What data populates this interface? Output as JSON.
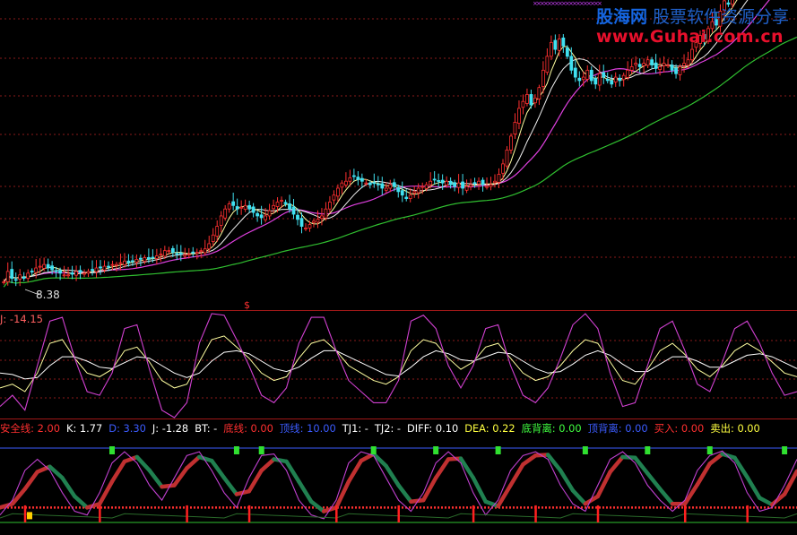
{
  "watermark": {
    "brand": "股海网",
    "tagline": "股票软件资源分享",
    "url": "www.Guhai.com.cn"
  },
  "main_panel": {
    "low_price_label": "8.38",
    "marker": "$"
  },
  "kdj_panel": {
    "j_readout": "J: -14.15"
  },
  "legend": [
    {
      "text": "安全线: 2.00",
      "color": "#ff3030"
    },
    {
      "text": "K: 1.77",
      "color": "#ffffff"
    },
    {
      "text": "D: 3.30",
      "color": "#3c5cff"
    },
    {
      "text": "J: -1.28",
      "color": "#ffffff"
    },
    {
      "text": "BT: -",
      "color": "#ffffff"
    },
    {
      "text": "底线: 0.00",
      "color": "#ff3030"
    },
    {
      "text": "顶线: 10.00",
      "color": "#3c5cff"
    },
    {
      "text": "TJ1: -",
      "color": "#ffffff"
    },
    {
      "text": "TJ2: -",
      "color": "#ffffff"
    },
    {
      "text": "DIFF: 0.10",
      "color": "#ffffff"
    },
    {
      "text": "DEA: 0.22",
      "color": "#ffff40"
    },
    {
      "text": "底背离: 0.00",
      "color": "#40ff40"
    },
    {
      "text": "顶背离: 0.00",
      "color": "#3c5cff"
    },
    {
      "text": "买入: 0.00",
      "color": "#ff3030"
    },
    {
      "text": "卖出: 0.00",
      "color": "#ffff40"
    }
  ],
  "colors": {
    "up": "#ff3030",
    "down": "#40e0f0",
    "ma_short": "#ffffff",
    "ma_mid": "#e040e0",
    "ma_long": "#30c030",
    "grid": "#8a1a1a"
  },
  "chart_data": [
    {
      "type": "line",
      "name": "price candlestick with moving averages",
      "x_count": 200,
      "close": [
        8.4,
        8.7,
        8.5,
        8.45,
        8.6,
        8.5,
        8.65,
        8.7,
        8.8,
        8.85,
        8.9,
        8.8,
        8.75,
        8.7,
        8.65,
        8.6,
        8.6,
        8.62,
        8.7,
        8.68,
        8.65,
        8.7,
        8.72,
        8.8,
        8.8,
        8.85,
        8.82,
        8.9,
        8.9,
        8.95,
        9,
        8.95,
        9,
        9.05,
        9.05,
        9.1,
        9.05,
        9.1,
        9.15,
        9.2,
        9.3,
        9.3,
        9.25,
        9.2,
        9.2,
        9.18,
        9.2,
        9.25,
        9.25,
        9.3,
        9.35,
        9.5,
        9.75,
        10,
        10.3,
        10.5,
        10.65,
        10.6,
        10.5,
        10.55,
        10.6,
        10.5,
        10.4,
        10.3,
        10.25,
        10.3,
        10.45,
        10.6,
        10.7,
        10.75,
        10.65,
        10.5,
        10.35,
        10.2,
        10,
        9.95,
        10.05,
        10.15,
        10.2,
        10.3,
        10.5,
        10.7,
        10.9,
        11.1,
        11.25,
        11.3,
        11.4,
        11.45,
        11.35,
        11.3,
        11.25,
        11.2,
        11.25,
        11.2,
        11.1,
        11.1,
        11.2,
        11.15,
        11,
        10.9,
        10.8,
        10.9,
        11,
        11.1,
        11.15,
        11.2,
        11.3,
        11.35,
        11.3,
        11.25,
        11.3,
        11.2,
        11.15,
        11.25,
        11.1,
        11.15,
        11.2,
        11.25,
        11.3,
        11.2,
        11.15,
        11.2,
        11.3,
        11.5,
        11.8,
        12.2,
        12.6,
        13,
        13.4,
        13.6,
        13.8,
        13.5,
        13.7,
        14,
        14.5,
        14.9,
        15.3,
        15.1,
        15.4,
        15.2,
        14.9,
        14.5,
        14.3,
        14.2,
        14.3,
        14.5,
        14.2,
        14.1,
        14.4,
        14.3,
        14.2,
        14.1,
        14.3,
        14.2,
        14.35,
        14.5,
        14.6,
        14.7,
        14.6,
        14.7,
        14.8,
        14.65,
        14.55,
        14.6,
        14.7,
        14.65,
        14.5,
        14.4,
        14.6,
        14.7,
        14.8,
        15.1,
        15.3,
        15.5,
        15.4,
        15.7,
        15.9,
        15.8,
        16.2,
        16.5,
        16.4,
        16.6,
        16.8,
        17,
        17.1,
        17.3,
        17.2,
        17.4,
        17.5,
        17.6,
        17.7,
        17.8,
        17.9,
        18,
        18.1,
        18.2,
        18.3,
        18.4
      ],
      "y_range": [
        8.0,
        15.8
      ],
      "annotations": [
        "8.38"
      ]
    },
    {
      "type": "line",
      "name": "KDJ",
      "y_range": [
        -20,
        120
      ],
      "series": [
        {
          "values": [
            20,
            25,
            15,
            40,
            80,
            85,
            60,
            40,
            35,
            45,
            70,
            75,
            55,
            30,
            20,
            25,
            55,
            85,
            90,
            75,
            60,
            40,
            30,
            35,
            60,
            80,
            85,
            70,
            50,
            40,
            30,
            25,
            35,
            70,
            85,
            80,
            60,
            45,
            55,
            75,
            80,
            60,
            40,
            30,
            35,
            50,
            70,
            85,
            80,
            55,
            30,
            25,
            45,
            70,
            80,
            65,
            45,
            35,
            50,
            70,
            80,
            70,
            55,
            40,
            35
          ]
        },
        {
          "values": [
            40,
            38,
            32,
            34,
            50,
            62,
            62,
            56,
            48,
            46,
            54,
            62,
            60,
            50,
            40,
            34,
            40,
            56,
            68,
            70,
            66,
            56,
            46,
            42,
            48,
            60,
            70,
            70,
            62,
            54,
            46,
            38,
            36,
            48,
            62,
            70,
            66,
            58,
            56,
            62,
            68,
            66,
            56,
            46,
            40,
            42,
            52,
            64,
            70,
            64,
            52,
            42,
            42,
            52,
            62,
            62,
            56,
            48,
            48,
            56,
            64,
            66,
            62,
            54,
            46
          ]
        },
        {
          "values": [
            -5,
            10,
            -10,
            50,
            110,
            115,
            60,
            15,
            10,
            40,
            100,
            105,
            45,
            -10,
            -20,
            0,
            80,
            120,
            118,
            85,
            50,
            10,
            0,
            20,
            80,
            115,
            115,
            70,
            30,
            15,
            0,
            0,
            30,
            110,
            118,
            100,
            50,
            20,
            50,
            100,
            105,
            50,
            10,
            0,
            20,
            60,
            105,
            120,
            100,
            40,
            -5,
            0,
            50,
            100,
            110,
            70,
            25,
            15,
            55,
            100,
            110,
            80,
            40,
            10,
            15
          ]
        }
      ],
      "annotations": [
        "J: -14.15"
      ]
    },
    {
      "type": "area",
      "name": "bottom-top divergence indicator",
      "y_range": [
        0,
        10
      ],
      "series": [
        {
          "name": "K",
          "values": [
            1,
            3,
            7,
            8.5,
            7,
            4,
            1.5,
            1,
            4,
            8,
            9.5,
            8,
            5,
            3,
            6,
            9,
            9.5,
            7,
            4,
            2,
            6,
            9,
            9.2,
            7,
            3,
            1,
            0.5,
            3,
            8,
            9.5,
            9,
            6,
            3,
            1.5,
            4,
            8,
            9.5,
            8,
            4,
            1,
            3,
            7,
            9,
            9.5,
            8.5,
            5,
            2.5,
            1.5,
            5,
            8.5,
            9.5,
            8,
            5,
            3,
            1.5,
            3,
            7,
            9,
            9.6,
            8,
            4,
            1.5,
            2,
            5,
            8.5
          ]
        },
        {
          "name": "D",
          "values": [
            2,
            2.5,
            4.5,
            6.8,
            7.5,
            6,
            3.5,
            2,
            2.5,
            5.5,
            8.2,
            8.8,
            7,
            4.8,
            5,
            7.3,
            8.8,
            8.3,
            6,
            3.8,
            4.2,
            7,
            8.5,
            8.2,
            5.5,
            2.8,
            1.5,
            2,
            5.5,
            8.3,
            9.2,
            7.6,
            5,
            2.8,
            3,
            6,
            8.5,
            8.6,
            6,
            2.8,
            2.2,
            5,
            7.8,
            9,
            9.1,
            7,
            4.3,
            2.5,
            3.5,
            6.8,
            8.8,
            8.7,
            6.6,
            4.5,
            2.5,
            2.5,
            5.1,
            7.9,
            9.2,
            8.7,
            6.1,
            3.3,
            2.4,
            3.8,
            6.9
          ]
        }
      ],
      "buy_signals": [
        2,
        8,
        15,
        20,
        27,
        32,
        38,
        43,
        48,
        55,
        60
      ],
      "sell_signals": [
        9,
        19,
        21,
        30,
        35,
        40,
        47,
        52,
        57,
        63
      ]
    }
  ]
}
